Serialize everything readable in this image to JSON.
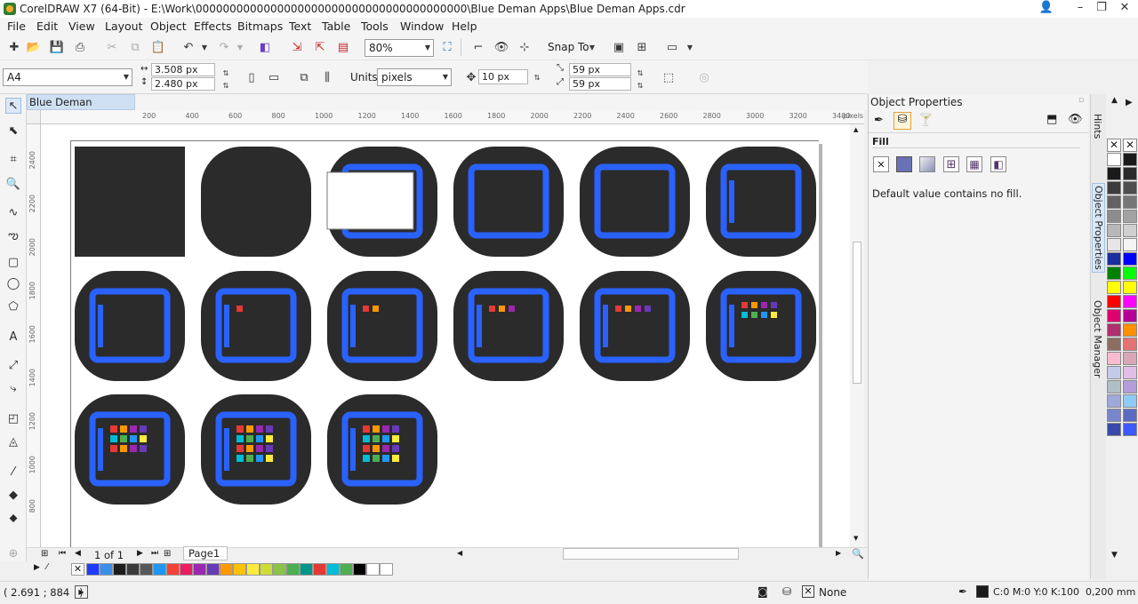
{
  "window": {
    "title": "CorelDRAW X7 (64-Bit) - E:\\Work\\0000000000000000000000000000000000000000\\Blue Deman Apps\\Blue Deman Apps.cdr"
  },
  "menu": [
    "File",
    "Edit",
    "View",
    "Layout",
    "Object",
    "Effects",
    "Bitmaps",
    "Text",
    "Table",
    "Tools",
    "Window",
    "Help"
  ],
  "toolbar": {
    "zoom": "80%",
    "snap_to": "Snap To"
  },
  "property_bar": {
    "page_size": "A4",
    "width": "3.508 px",
    "height": "2.480 px",
    "units_label": "Units:",
    "units": "pixels",
    "nudge": "10 px",
    "dup_x": "59 px",
    "dup_y": "59 px"
  },
  "document": {
    "tab": "Blue Deman Apps.cdr",
    "ruler_unit": "pixels",
    "h_ticks": [
      "200",
      "400",
      "600",
      "800",
      "1000",
      "1200",
      "1400",
      "1600",
      "1800",
      "2000",
      "2200",
      "2400",
      "2600",
      "2800",
      "3000",
      "3200",
      "3400"
    ],
    "v_ticks": [
      "2400",
      "2200",
      "2000",
      "1800",
      "1600",
      "1400",
      "1200",
      "1000",
      "800"
    ]
  },
  "page_nav": {
    "counter": "1 of 1",
    "page_tab": "Page1"
  },
  "status": {
    "coords": "( 2.691 ; 884   )",
    "fill": "None",
    "outline": "C:0 M:0 Y:0 K:100  0,200 mm"
  },
  "docker": {
    "title": "Object Properties",
    "section": "Fill",
    "message": "Default value contains no fill.",
    "tabs": [
      "Hints",
      "Object Properties",
      "Object Manager"
    ]
  },
  "colors": {
    "accent": "#2962ff",
    "tile": "#2b2b2b",
    "grid": [
      "#e53935",
      "#ff9800",
      "#9c27b0",
      "#673ab7",
      "#00bcd4",
      "#4caf50",
      "#2196f3",
      "#ffeb3b"
    ]
  },
  "bottom_palette": [
    "#1e3cff",
    "#3b8eea",
    "#1c1c1c",
    "#3a3a3a",
    "#585858",
    "#2196f3",
    "#f44336",
    "#e91e63",
    "#9c27b0",
    "#673ab7",
    "#ff9800",
    "#ffc107",
    "#ffeb3b",
    "#cddc39",
    "#8bc34a",
    "#4caf50",
    "#009688",
    "#e53935",
    "#00bcd4",
    "#4caf50",
    "#000000",
    "#ffffff",
    "#ffffff"
  ],
  "side_palette": [
    "#ffffff",
    "#1a1a1a",
    "#1a1a1a",
    "#2a2a2a",
    "#3c3c3c",
    "#4e4e4e",
    "#626262",
    "#777777",
    "#8c8c8c",
    "#a2a2a2",
    "#b8b8b8",
    "#d0d0d0",
    "#e6e6e6",
    "#f4f4f4",
    "#1b2ea0",
    "#0000ff",
    "#008000",
    "#00ff00",
    "#ffff00",
    "#ffff00",
    "#ff0000",
    "#ff00ff",
    "#e0006e",
    "#b40096",
    "#b0306e",
    "#ff9000",
    "#8d6e63",
    "#e57373",
    "#f8bbd0",
    "#d7a7b8",
    "#c5cae9",
    "#e1bee7",
    "#b0bec5",
    "#b39ddb",
    "#9fa8da",
    "#90caf9",
    "#7986cb",
    "#5c6bc0",
    "#3949ab",
    "#3d5afe"
  ]
}
